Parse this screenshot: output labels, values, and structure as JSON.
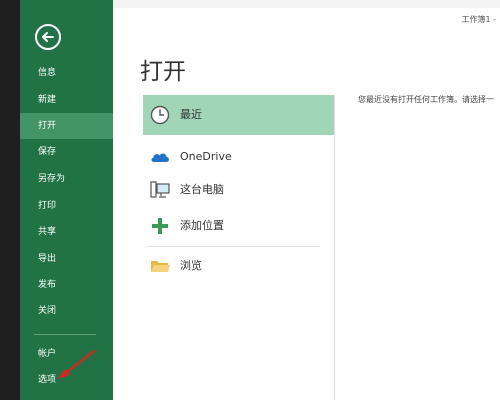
{
  "window": {
    "title": "工作簿1 -"
  },
  "backstage": {
    "back_icon": "arrow-left-icon",
    "items": [
      {
        "label": "信息"
      },
      {
        "label": "新建"
      },
      {
        "label": "打开"
      },
      {
        "label": "保存"
      },
      {
        "label": "另存为"
      },
      {
        "label": "打印"
      },
      {
        "label": "共享"
      },
      {
        "label": "导出"
      },
      {
        "label": "发布"
      },
      {
        "label": "关闭"
      },
      {
        "label": "帐户"
      },
      {
        "label": "选项"
      }
    ],
    "active_item": "打开",
    "colors": {
      "nav_bg": "#217346",
      "nav_active": "#439467",
      "selected_location": "#a0d5b5"
    }
  },
  "open": {
    "title": "打开",
    "locations": [
      {
        "label": "最近",
        "icon": "clock-icon"
      },
      {
        "label": "OneDrive",
        "icon": "cloud-icon"
      },
      {
        "label": "这台电脑",
        "icon": "computer-icon"
      },
      {
        "label": "添加位置",
        "icon": "plus-icon"
      },
      {
        "label": "浏览",
        "icon": "folder-icon"
      }
    ],
    "selected_location": "最近",
    "recent_message": "您最近没有打开任何工作簿。请选择一"
  },
  "annotation": {
    "type": "red-arrow",
    "points_to": "选项"
  }
}
